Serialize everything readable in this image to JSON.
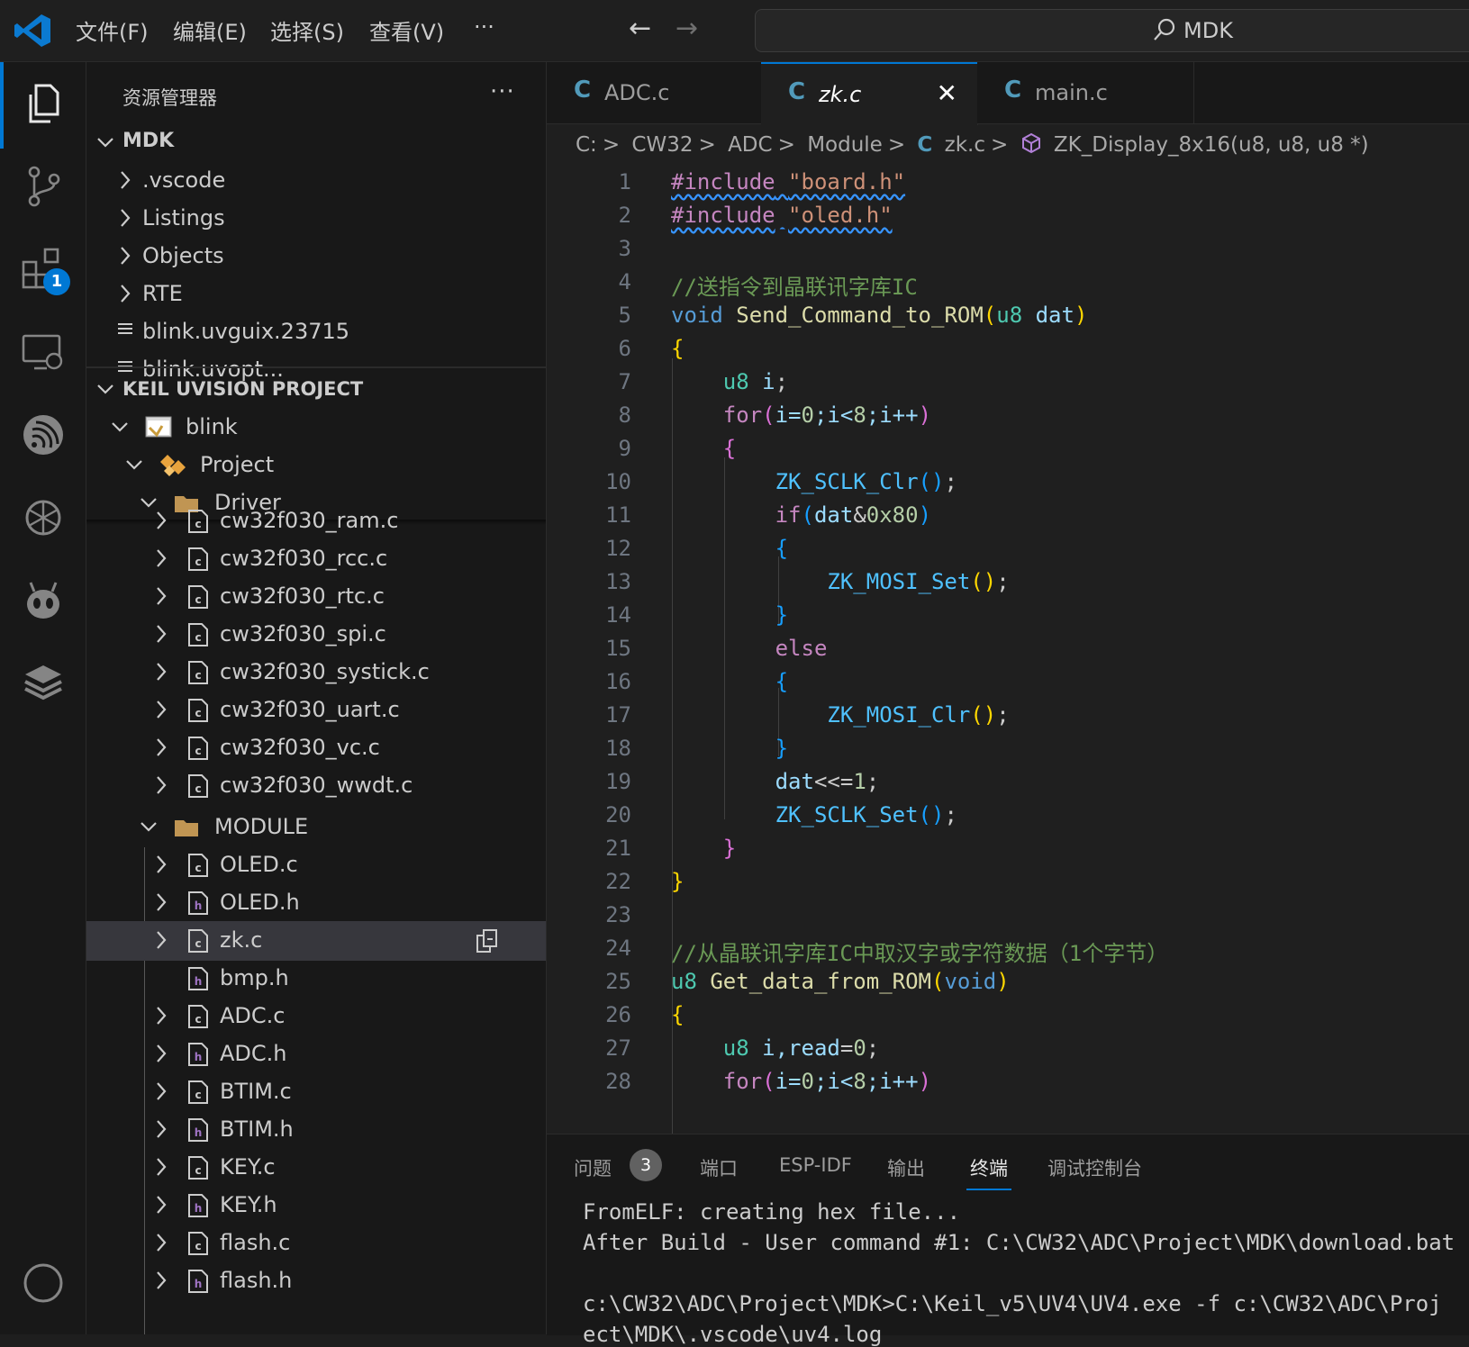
{
  "titlebar": {
    "menu": [
      "文件(F)",
      "编辑(E)",
      "选择(S)",
      "查看(V)",
      "···"
    ],
    "search_text": "MDK"
  },
  "activity": {
    "extensions_badge": "1"
  },
  "explorer": {
    "title": "资源管理器",
    "more": "···",
    "mdk_section": "MDK",
    "mdk_items": [
      ".vscode",
      "Listings",
      "Objects",
      "RTE",
      "blink.uvguix.23715",
      "blink.uvopt..."
    ],
    "keil_section": "KEIL UVISION PROJECT",
    "target": "blink",
    "project": "Project",
    "driver_folder": "Driver",
    "driver_files": [
      "cw32f030_ram.c",
      "cw32f030_rcc.c",
      "cw32f030_rtc.c",
      "cw32f030_spi.c",
      "cw32f030_systick.c",
      "cw32f030_uart.c",
      "cw32f030_vc.c",
      "cw32f030_wwdt.c"
    ],
    "module_folder": "MODULE",
    "module_files": [
      "OLED.c",
      "OLED.h",
      "zk.c",
      "bmp.h",
      "ADC.c",
      "ADC.h",
      "BTIM.c",
      "BTIM.h",
      "KEY.c",
      "KEY.h",
      "flash.c",
      "flash.h"
    ]
  },
  "tabs": [
    {
      "label": "ADC.c",
      "icon": "C"
    },
    {
      "label": "zk.c",
      "icon": "C"
    },
    {
      "label": "main.c",
      "icon": "C"
    }
  ],
  "close_glyph": "✕",
  "breadcrumb": [
    "C:",
    "CW32",
    "ADC",
    "Module",
    "C",
    "zk.c",
    "ZK_Display_8x16(u8, u8, u8 *)"
  ],
  "breadcrumb_sep": ">",
  "line_numbers": [
    "1",
    "2",
    "3",
    "4",
    "5",
    "6",
    "7",
    "8",
    "9",
    "10",
    "11",
    "12",
    "13",
    "14",
    "15",
    "16",
    "17",
    "18",
    "19",
    "20",
    "21",
    "22",
    "23",
    "24",
    "25",
    "26",
    "27",
    "28"
  ],
  "code": {
    "inc1_kw": "#include",
    "inc1_str": "\"board.h\"",
    "inc2_kw": "#include",
    "inc2_str": "\"oled.h\"",
    "cm1": "//送指令到晶联讯字库IC",
    "l5_void": "void",
    "l5_fn": "Send_Command_to_ROM",
    "l5_ty": "u8",
    "l5_var": "dat",
    "l7_ty": "u8",
    "l7_var": "i",
    "for": "for",
    "if": "if",
    "else": "else",
    "l8_rest1": "i=",
    "l8_n0": "0",
    "l8_rest2": ";i<",
    "l8_n8": "8",
    "l8_rest3": ";i++",
    "clr": "ZK_SCLK_Clr",
    "set_sclk": "ZK_SCLK_Set",
    "mosi_set": "ZK_MOSI_Set",
    "mosi_clr": "ZK_MOSI_Clr",
    "l11_var": "dat",
    "l11_amp": "&",
    "l11_num": "0x80",
    "l19_var": "dat",
    "l19_op": "<<=",
    "l19_num": "1",
    "cm2": "//从晶联讯字库IC中取汉字或字符数据（1个字节）",
    "l25_ty": "u8",
    "l25_fn": "Get_data_from_ROM",
    "l25_void": "void",
    "l27_ty": "u8",
    "l27_vars": "i,read",
    "l27_num": "0"
  },
  "panel": {
    "tabs": [
      "问题",
      "端口",
      "ESP-IDF",
      "输出",
      "终端",
      "调试控制台"
    ],
    "problems_count": "3",
    "terminal_lines": [
      "FromELF: creating hex file...",
      "After Build - User command #1: C:\\CW32\\ADC\\Project\\MDK\\download.bat",
      "",
      "c:\\CW32\\ADC\\Project\\MDK>C:\\Keil_v5\\UV4\\UV4.exe -f c:\\CW32\\ADC\\Proj",
      "ect\\MDK\\.vscode\\uv4.log"
    ]
  },
  "colors": {
    "accent": "#0078d4",
    "editor_bg": "#1f1f1f",
    "sidebar_bg": "#181818"
  }
}
